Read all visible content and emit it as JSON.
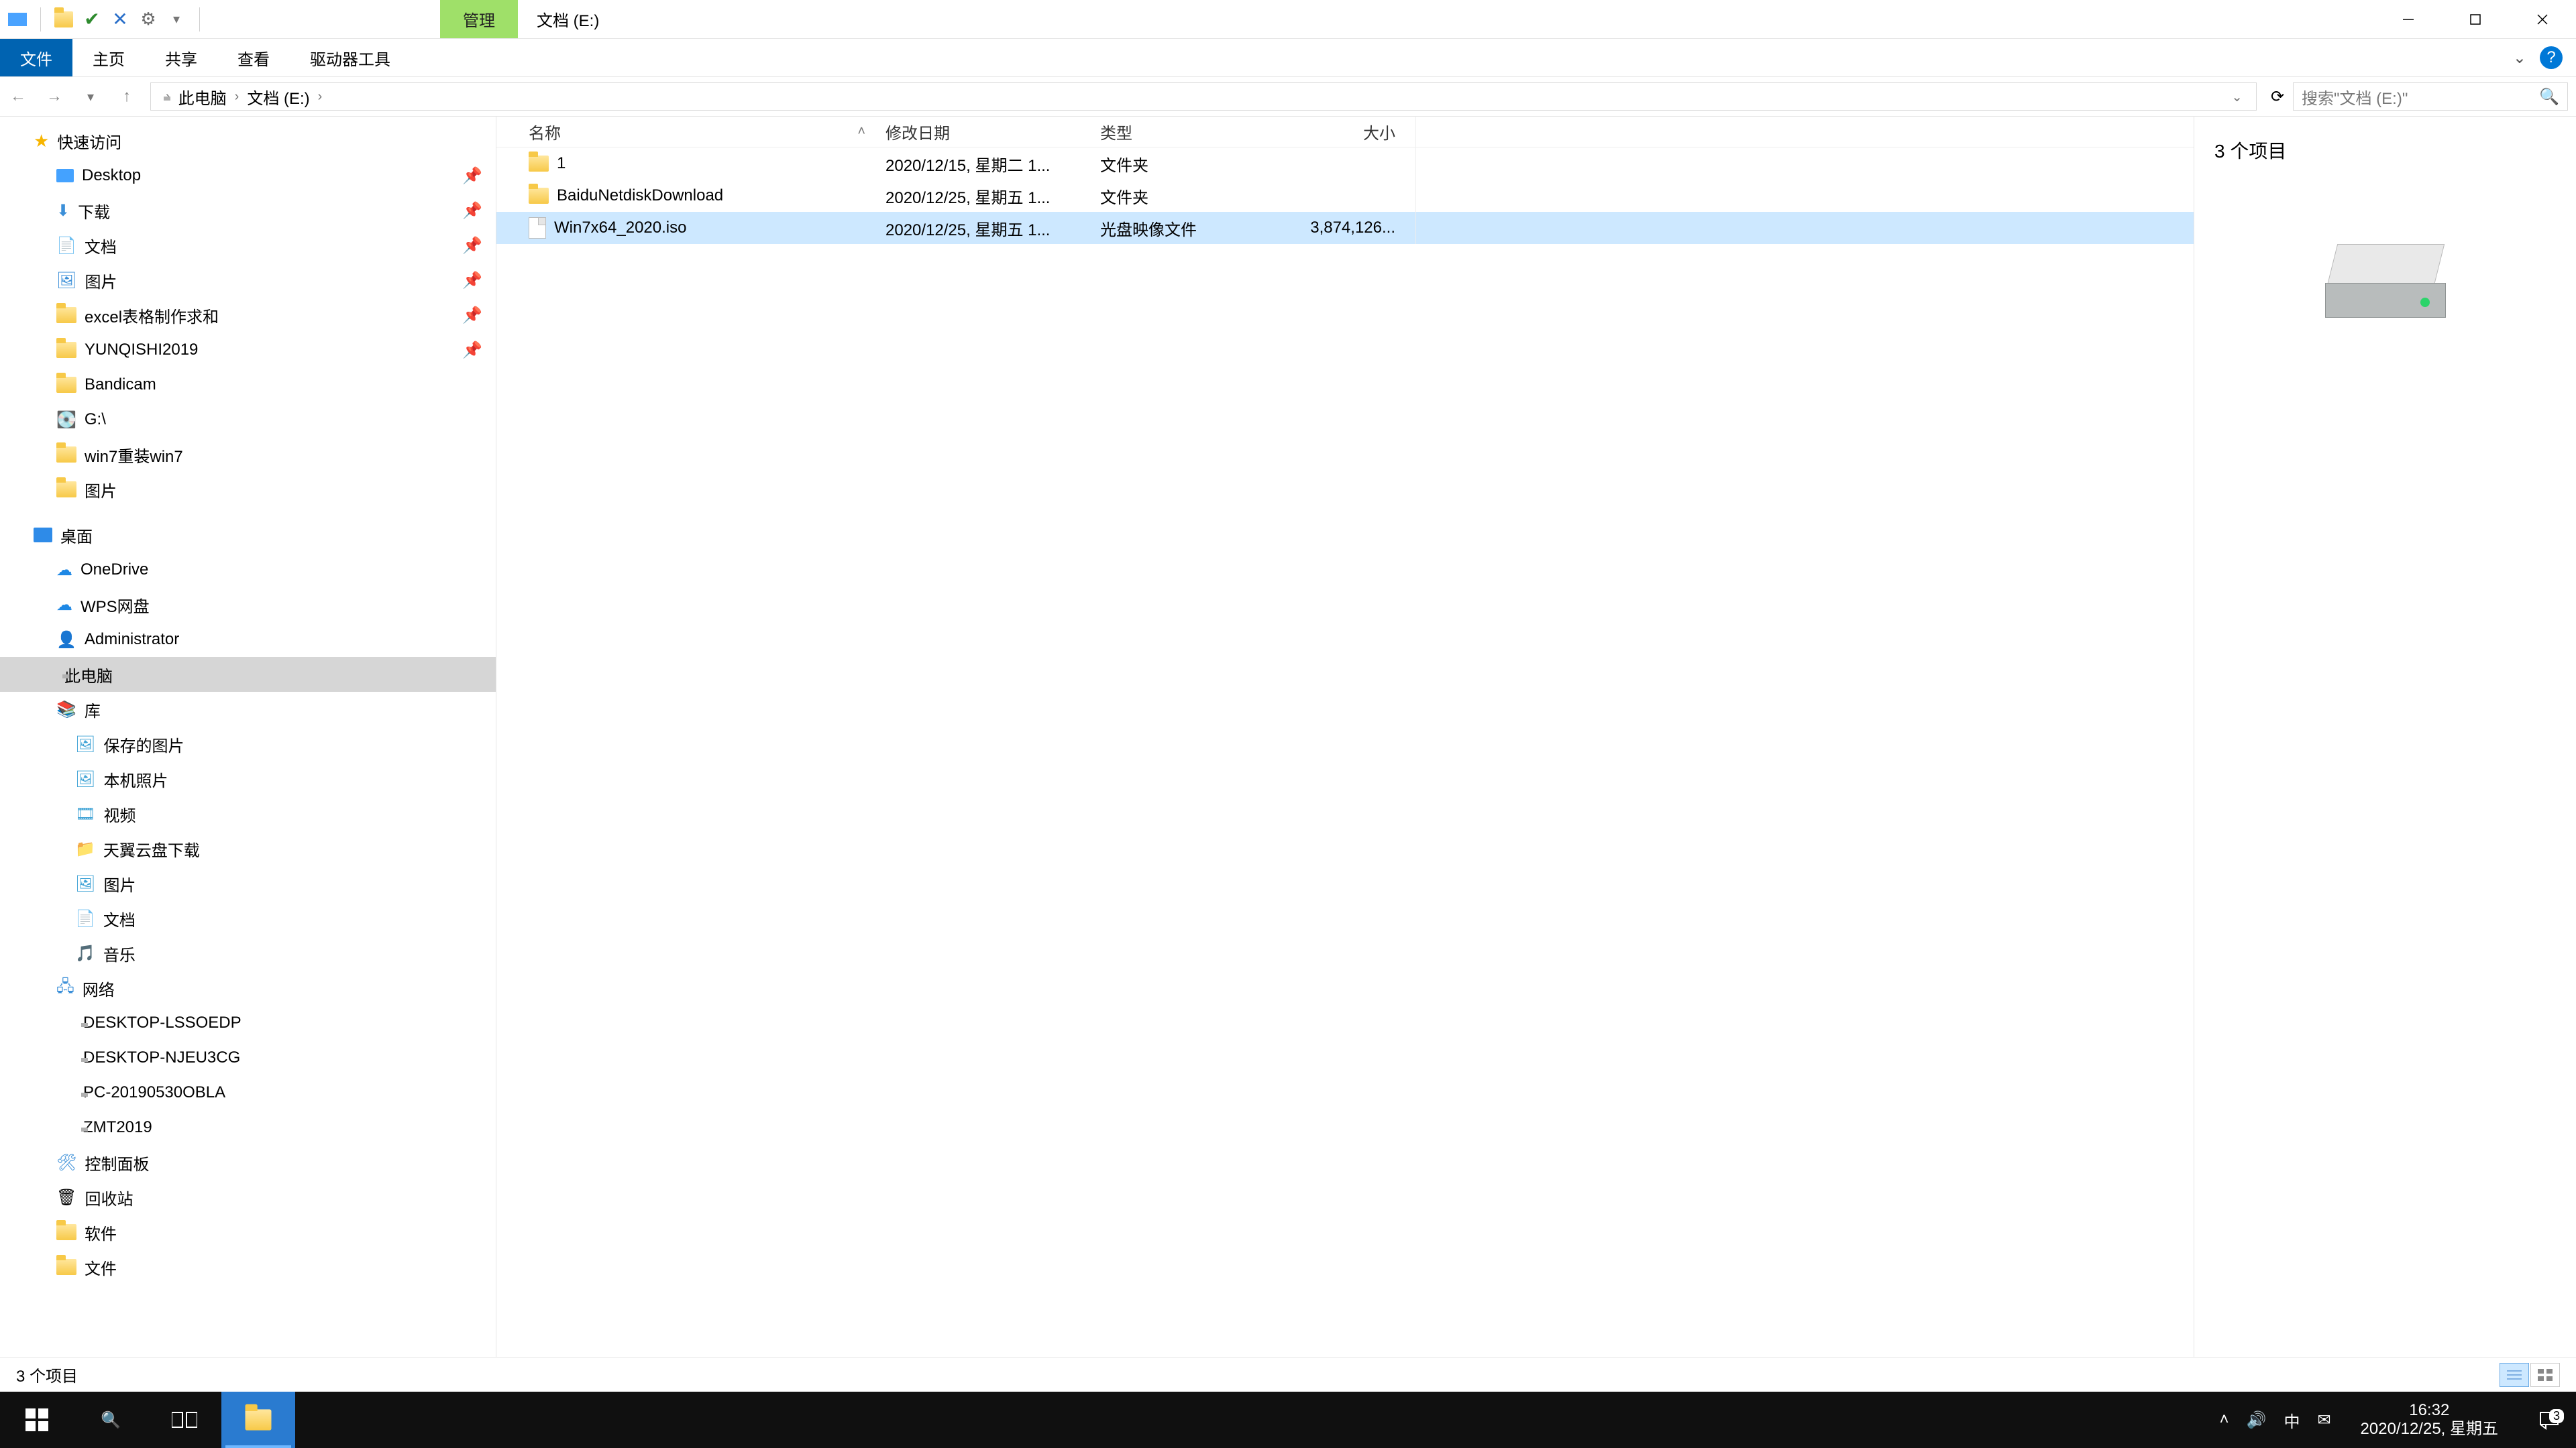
{
  "window": {
    "contextual_tab": "管理",
    "title": "文档 (E:)",
    "controls": {
      "min": "minimize",
      "max": "maximize",
      "close": "close"
    }
  },
  "ribbon": {
    "file": "文件",
    "tabs": [
      "主页",
      "共享",
      "查看",
      "驱动器工具"
    ],
    "expand_icon": "chevron-down",
    "help_icon": "help"
  },
  "nav": {
    "back_icon": "arrow-left",
    "forward_icon": "arrow-right",
    "recent_icon": "chevron-down",
    "up_icon": "arrow-up",
    "pc_icon": "monitor",
    "crumbs": [
      "此电脑",
      "文档 (E:)"
    ],
    "dropdown_icon": "chevron-down",
    "refresh_icon": "refresh",
    "search_placeholder": "搜索\"文档 (E:)\"",
    "search_icon": "search"
  },
  "tree": {
    "quick_access": {
      "label": "快速访问",
      "icon": "star"
    },
    "quick_items": [
      {
        "label": "Desktop",
        "icon": "desktop",
        "pinned": true
      },
      {
        "label": "下载",
        "icon": "downloads",
        "pinned": true
      },
      {
        "label": "文档",
        "icon": "documents",
        "pinned": true
      },
      {
        "label": "图片",
        "icon": "pictures",
        "pinned": true
      },
      {
        "label": "excel表格制作求和",
        "icon": "folder",
        "pinned": true
      },
      {
        "label": "YUNQISHI2019",
        "icon": "folder",
        "pinned": true
      },
      {
        "label": "Bandicam",
        "icon": "folder",
        "pinned": false
      },
      {
        "label": "G:\\",
        "icon": "drive",
        "pinned": false
      },
      {
        "label": "win7重装win7",
        "icon": "folder",
        "pinned": false
      },
      {
        "label": "图片",
        "icon": "folder",
        "pinned": false
      }
    ],
    "desktop_root": {
      "label": "桌面",
      "icon": "desktop"
    },
    "desktop_items": [
      {
        "label": "OneDrive",
        "icon": "cloud-blue"
      },
      {
        "label": "WPS网盘",
        "icon": "cloud-blue"
      },
      {
        "label": "Administrator",
        "icon": "user"
      },
      {
        "label": "此电脑",
        "icon": "pc",
        "selected": true
      },
      {
        "label": "库",
        "icon": "libraries"
      }
    ],
    "library_items": [
      {
        "label": "保存的图片",
        "icon": "lib-pic"
      },
      {
        "label": "本机照片",
        "icon": "lib-pic"
      },
      {
        "label": "视频",
        "icon": "lib-video"
      },
      {
        "label": "天翼云盘下载",
        "icon": "lib-folder"
      },
      {
        "label": "图片",
        "icon": "lib-pic"
      },
      {
        "label": "文档",
        "icon": "lib-doc"
      },
      {
        "label": "音乐",
        "icon": "lib-music"
      }
    ],
    "network": {
      "label": "网络",
      "icon": "network"
    },
    "network_items": [
      {
        "label": "DESKTOP-LSSOEDP",
        "icon": "pc"
      },
      {
        "label": "DESKTOP-NJEU3CG",
        "icon": "pc"
      },
      {
        "label": "PC-20190530OBLA",
        "icon": "pc"
      },
      {
        "label": "ZMT2019",
        "icon": "pc"
      }
    ],
    "tail_items": [
      {
        "label": "控制面板",
        "icon": "control-panel"
      },
      {
        "label": "回收站",
        "icon": "recycle-bin"
      },
      {
        "label": "软件",
        "icon": "folder"
      },
      {
        "label": "文件",
        "icon": "folder"
      }
    ]
  },
  "list": {
    "headers": {
      "name": "名称",
      "date": "修改日期",
      "type": "类型",
      "size": "大小"
    },
    "rows": [
      {
        "icon": "folder",
        "name": "1",
        "date": "2020/12/15, 星期二 1...",
        "type": "文件夹",
        "size": ""
      },
      {
        "icon": "folder",
        "name": "BaiduNetdiskDownload",
        "date": "2020/12/25, 星期五 1...",
        "type": "文件夹",
        "size": ""
      },
      {
        "icon": "iso",
        "name": "Win7x64_2020.iso",
        "date": "2020/12/25, 星期五 1...",
        "type": "光盘映像文件",
        "size": "3,874,126...",
        "selected": true
      }
    ]
  },
  "preview": {
    "heading": "3 个项目"
  },
  "statusbar": {
    "text": "3 个项目"
  },
  "taskbar": {
    "start_icon": "windows",
    "search_icon": "search",
    "taskview_icon": "task-view",
    "explorer_icon": "file-explorer",
    "tray": {
      "chevron": "chevron-up",
      "volume": "volume",
      "ime": "中",
      "mail": "mail"
    },
    "clock": {
      "time": "16:32",
      "date": "2020/12/25, 星期五"
    },
    "notif_count": "3"
  }
}
